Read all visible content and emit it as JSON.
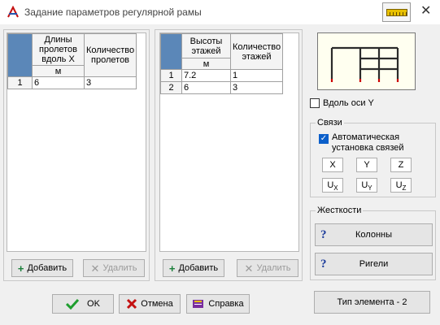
{
  "window": {
    "title": "Задание параметров регулярной рамы",
    "close_glyph": "✕"
  },
  "spans_table": {
    "headers": [
      "Длины пролетов вдоль X",
      "Количество пролетов"
    ],
    "unit": "м",
    "rows": [
      {
        "num": "1",
        "length": "6",
        "count": "3"
      }
    ],
    "add_label": "Добавить",
    "delete_label": "Удалить"
  },
  "floors_table": {
    "headers": [
      "Высоты этажей",
      "Количество этажей"
    ],
    "unit": "м",
    "rows": [
      {
        "num": "1",
        "height": "7.2",
        "count": "1"
      },
      {
        "num": "2",
        "height": "6",
        "count": "3"
      }
    ],
    "add_label": "Добавить",
    "delete_label": "Удалить"
  },
  "along_y": {
    "label": "Вдоль оси Y",
    "checked": false
  },
  "links": {
    "title": "Связи",
    "auto_label": "Автоматическая установка связей",
    "auto_checked": true,
    "axes": [
      "X",
      "Y",
      "Z"
    ],
    "rotations": [
      {
        "base": "U",
        "sub": "X"
      },
      {
        "base": "U",
        "sub": "Y"
      },
      {
        "base": "U",
        "sub": "Z"
      }
    ]
  },
  "stiffness": {
    "title": "Жесткости",
    "columns_label": "Колонны",
    "beams_label": "Ригели"
  },
  "footer": {
    "ok_label": "OK",
    "cancel_label": "Отмена",
    "help_label": "Справка",
    "element_type_label": "Тип элемента - 2"
  },
  "colors": {
    "frame_line": "#2b2b2b",
    "support": "#cc0000",
    "ok_check": "#1e9e2e",
    "cancel_x": "#c41010",
    "accent": "#0b5fca"
  },
  "icons": [
    "app-icon",
    "ruler-icon",
    "close-icon",
    "add-icon",
    "delete-icon",
    "check-icon",
    "cancel-icon",
    "help-book-icon",
    "question-icon"
  ]
}
